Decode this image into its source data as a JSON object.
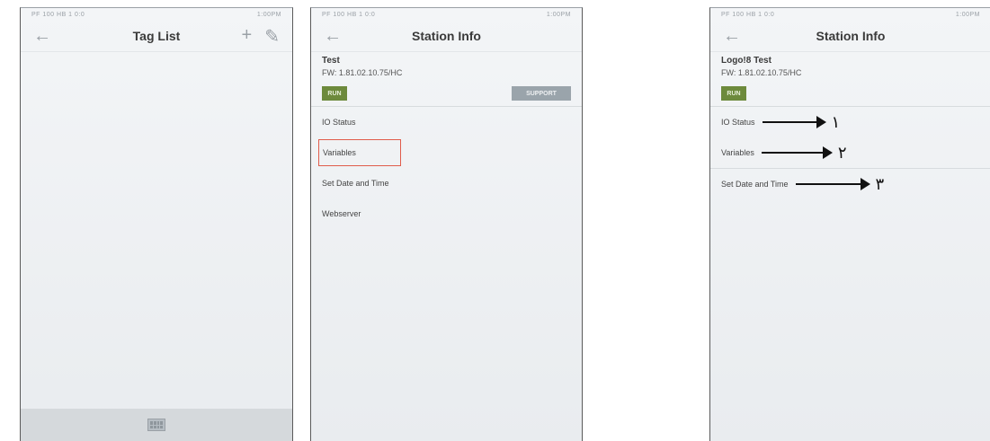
{
  "screen1": {
    "status_left": "PF 100 HB 1 0:0",
    "status_right": "1:00PM",
    "title": "Tag List",
    "back_icon": "back-arrow-icon",
    "add_icon": "plus-icon",
    "edit_icon": "pencil-icon",
    "bottom_icon": "keyboard-icon"
  },
  "screen2": {
    "status_left": "PF 100 HB 1 0:0",
    "status_right": "1:00PM",
    "title": "Station Info",
    "station_name": "Test",
    "firmware": "FW: 1.81.02.10.75/HC",
    "run_label": "RUN",
    "support_label": "SUPPORT",
    "menu": [
      "IO Status",
      "Variables",
      "Set Date and Time",
      "Webserver"
    ],
    "highlight_color": "#e05c4b"
  },
  "screen3": {
    "status_left": "PF 100 HB 1 0:0",
    "status_right": "1:00PM",
    "title": "Station Info",
    "station_name": "Logo!8 Test",
    "firmware": "FW: 1.81.02.10.75/HC",
    "run_label": "RUN",
    "menu": [
      "IO Status",
      "Variables",
      "Set Date and Time"
    ],
    "annotations": [
      "١",
      "٢",
      "٣"
    ]
  },
  "colors": {
    "run_green": "#6d8a3c",
    "support_gray": "#9aa4ab"
  }
}
